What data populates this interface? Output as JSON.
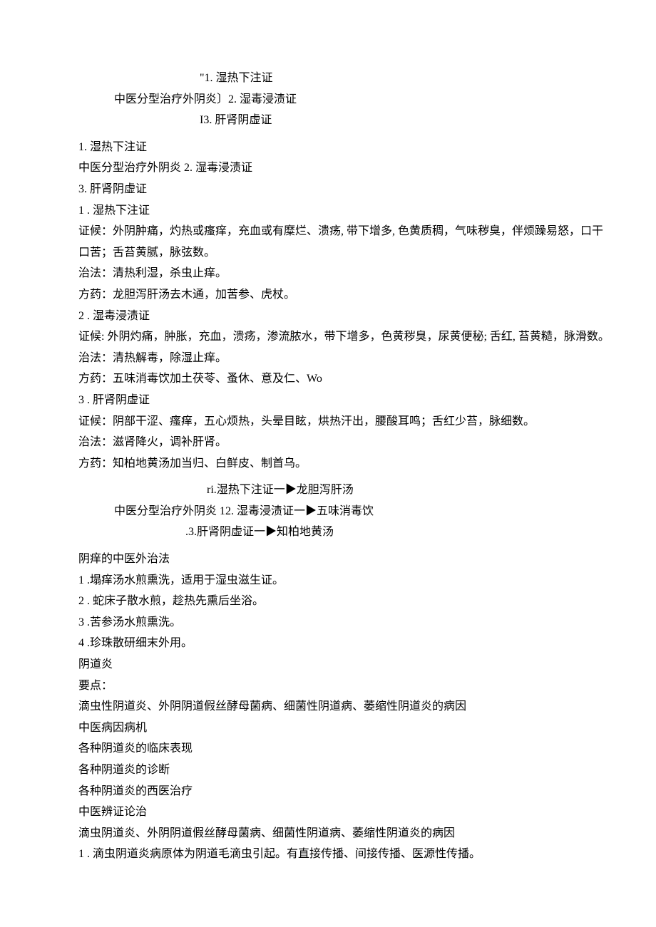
{
  "header_block": {
    "line1": "\"1. 湿热下注证",
    "line2": "中医分型治疗外阴炎〕2. 湿毒浸渍证",
    "line3": "I3. 肝肾阴虚证"
  },
  "intro": {
    "l1": "1. 湿热下注证",
    "l2": "中医分型治疗外阴炎 2. 湿毒浸渍证",
    "l3": "3. 肝肾阴虚证"
  },
  "section1": {
    "title": "1 . 湿热下注证",
    "zhenghou": "证候：外阴肿痛，灼热或瘙痒，充血或有糜烂、溃疡, 带下增多, 色黄质稠，气味秽臭，伴烦躁易怒，口干口苦；舌苔黄腻，脉弦数。",
    "zhifa": "治法：清热利湿，杀虫止痒。",
    "fangyao": "方药：龙胆泻肝汤去木通，加苦参、虎杖。"
  },
  "section2": {
    "title": "2 . 湿毒浸渍证",
    "zhenghou": "证候: 外阴灼痛，肿胀，充血，溃疡，渗流脓水，带下增多，色黄秽臭，尿黄便秘; 舌红, 苔黄糙，脉滑数。",
    "zhifa": "治法：清热解毒，除湿止痒。",
    "fangyao": "方药：五味消毒饮加土茯苓、蚤休、意及仁、Wo"
  },
  "section3": {
    "title": "3 . 肝肾阴虚证",
    "zhenghou": "证候：阴部干涩、瘙痒，五心烦热，头晕目眩，烘热汗出，腰酸耳鸣；舌红少苔，脉细数。",
    "zhifa": "治法：滋肾降火，调补肝肾。",
    "fangyao": "方药：知柏地黄汤加当归、白鲜皮、制首乌。"
  },
  "mapping_block": {
    "line1": "ri.湿热下注证一▶龙胆泻肝汤",
    "line2": "中医分型治疗外阴炎 12. 湿毒浸渍证一▶五味消毒饮",
    "line3": ".3.肝肾阴虚证一▶知柏地黄汤"
  },
  "waizhi": {
    "title": "阴痒的中医外治法",
    "items": [
      "1 .塌痒汤水煎熏洗，适用于湿虫滋生证。",
      "2 . 蛇床子散水煎，趁热先熏后坐浴。",
      "3 .苦参汤水煎熏洗。",
      "4 .珍珠散研细末外用。"
    ]
  },
  "ydy": {
    "t1": "阴道炎",
    "t2": "要点：",
    "lines": [
      "滴虫性阴道炎、外阴阴道假丝酵母菌病、细菌性阴道病、萎缩性阴道炎的病因",
      "中医病因病机",
      "各种阴道炎的临床表现",
      "各种阴道炎的诊断",
      "各种阴道炎的西医治疗",
      "中医辨证论治",
      "滴虫阴道炎、外阴阴道假丝酵母菌病、细菌性阴道病、萎缩性阴道炎的病因",
      "1 . 滴虫阴道炎病原体为阴道毛滴虫引起。有直接传播、间接传播、医源性传播。"
    ]
  }
}
